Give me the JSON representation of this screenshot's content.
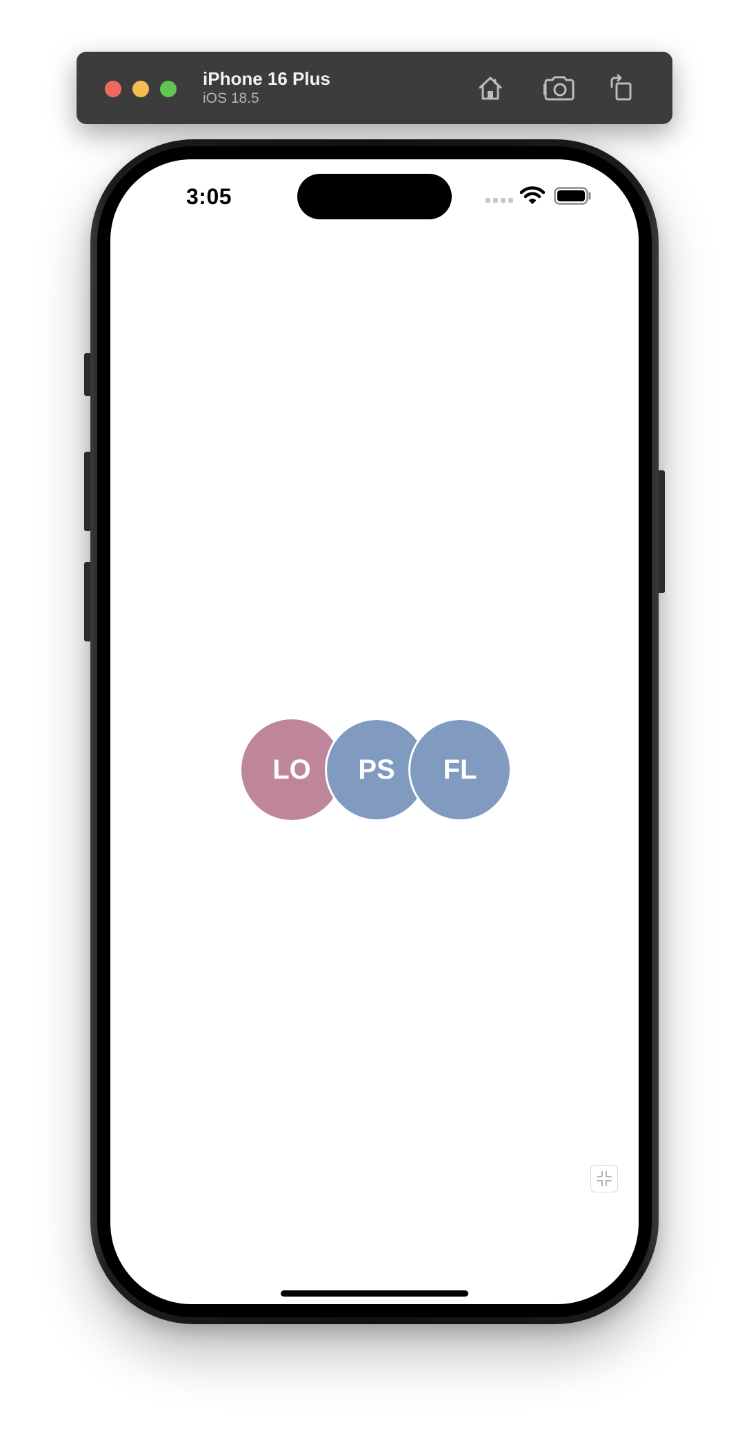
{
  "simulator": {
    "device_name": "iPhone 16 Plus",
    "os_version": "iOS 18.5",
    "traffic_lights": {
      "close_color": "#ee6a5f",
      "minimize_color": "#f5bd4f",
      "zoom_color": "#61c454"
    },
    "toolbar_icons": [
      "home-icon",
      "camera-icon",
      "rotate-icon"
    ]
  },
  "status_bar": {
    "time": "3:05",
    "icons": [
      "cellular-signal-icon",
      "wifi-icon",
      "battery-icon"
    ]
  },
  "avatars": [
    {
      "initials": "LO",
      "color": "#be859b"
    },
    {
      "initials": "PS",
      "color": "#819ac0"
    },
    {
      "initials": "FL",
      "color": "#819ac0"
    }
  ],
  "controls": {
    "corner_icon": "collapse-arrows-icon"
  }
}
